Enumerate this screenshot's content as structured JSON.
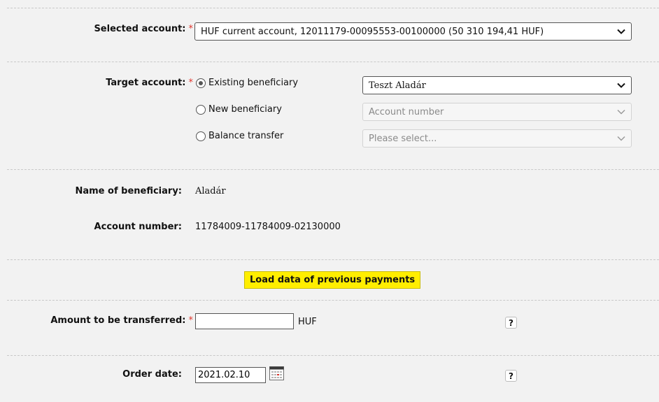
{
  "form": {
    "selected_account": {
      "label": "Selected account:",
      "required_marker": "*",
      "value": "HUF current account, 12011179-00095553-00100000 (50 310 194,41 HUF)"
    },
    "target_account": {
      "label": "Target account:",
      "required_marker": "*",
      "options": [
        {
          "label": "Existing beneficiary",
          "checked": true
        },
        {
          "label": "New beneficiary",
          "checked": false
        },
        {
          "label": "Balance transfer",
          "checked": false
        }
      ],
      "beneficiary_select": "Teszt Aladár",
      "account_number_placeholder": "Account number",
      "balance_transfer_placeholder": "Please select..."
    },
    "beneficiary_info": {
      "name_label": "Name of beneficiary:",
      "name_value": "Aladár",
      "account_label": "Account number:",
      "account_value": "11784009-11784009-02130000"
    },
    "load_button": "Load data of previous payments",
    "amount": {
      "label": "Amount to be transferred:",
      "required_marker": "*",
      "value": "",
      "currency": "HUF",
      "help": "?"
    },
    "order_date": {
      "label": "Order date:",
      "value": "2021.02.10",
      "help": "?"
    }
  }
}
